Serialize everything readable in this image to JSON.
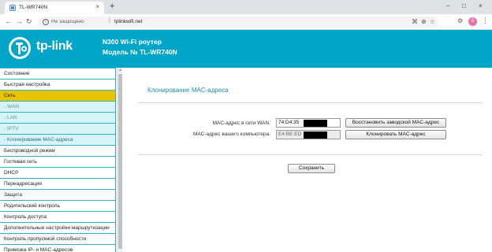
{
  "browser": {
    "tab_title": "TL-WR740N",
    "tab_close": "×",
    "new_tab": "+",
    "window_controls": [
      "–",
      "□",
      "×"
    ],
    "not_secure": "Не защищено",
    "url_separator": "|",
    "url": "tplinkwifi.net",
    "profile_initial": "S",
    "icons": [
      "back-icon",
      "forward-icon",
      "reload-icon",
      "info-icon",
      "translate-icon",
      "zoom-icon",
      "star-icon",
      "extension-icon",
      "menu-icon"
    ]
  },
  "header": {
    "logo_text": "tp-link",
    "title": "N300 Wi-Fi роутер",
    "subtitle": "Модель № TL-WR740N",
    "background": "#00a5c8"
  },
  "sidebar": {
    "items": [
      {
        "label": "Состояние",
        "type": "main"
      },
      {
        "label": "Быстрая настройка",
        "type": "main"
      },
      {
        "label": "Сеть",
        "type": "active"
      },
      {
        "label": "- WAN",
        "type": "sub"
      },
      {
        "label": "- LAN",
        "type": "sub"
      },
      {
        "label": "- IPTV",
        "type": "sub"
      },
      {
        "label": "- Клонирование MAC-адреса",
        "type": "sub-current"
      },
      {
        "label": "Беспроводной режим",
        "type": "main"
      },
      {
        "label": "Гостевая сеть",
        "type": "main"
      },
      {
        "label": "DHCP",
        "type": "main"
      },
      {
        "label": "Переадресация",
        "type": "main"
      },
      {
        "label": "Защита",
        "type": "main"
      },
      {
        "label": "Родительский контроль",
        "type": "main"
      },
      {
        "label": "Контроль доступа",
        "type": "main"
      },
      {
        "label": "Дополнительные настройки маршрутизации",
        "type": "main"
      },
      {
        "label": "Контроль пропускной способности",
        "type": "main"
      },
      {
        "label": "Привязка IP- и MAC-адресов",
        "type": "main"
      }
    ],
    "active_color": "#e8c400"
  },
  "main": {
    "section_title": "Клонирование MAC-адреса",
    "wan_mac_label": "MAC-адрес в сети WAN:",
    "wan_mac_value": "74:D4:35",
    "restore_button": "Восстановить заводской MAC-адрес",
    "pc_mac_label": "MAC-адрес вашего компьютера:",
    "pc_mac_value": "E4:BE:ED",
    "clone_button": "Клонировать MAC-адрес",
    "save_button": "Сохранить",
    "accent": "#1c8fb4"
  }
}
